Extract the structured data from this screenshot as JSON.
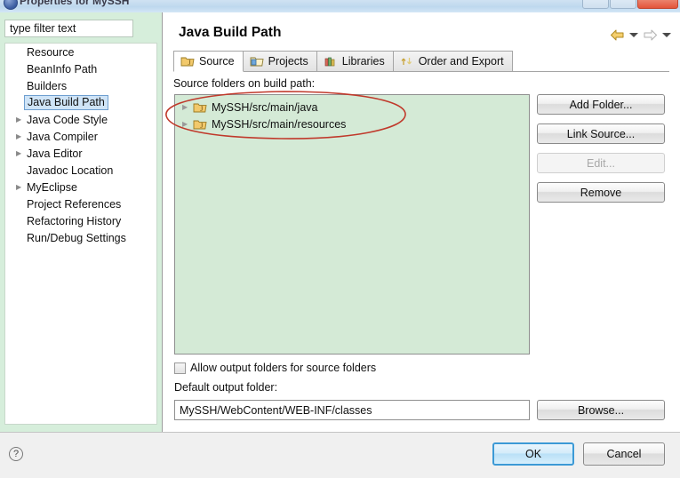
{
  "window": {
    "title": "Properties for MySSH",
    "icon": "properties-icon",
    "controls": {
      "minimize": "",
      "maximize": "",
      "close": ""
    }
  },
  "sidebar": {
    "filter": {
      "value": "type filter text",
      "placeholder": "type filter text"
    },
    "items": [
      {
        "label": "Resource",
        "expandable": false,
        "selected": false
      },
      {
        "label": "BeanInfo Path",
        "expandable": false,
        "selected": false
      },
      {
        "label": "Builders",
        "expandable": false,
        "selected": false
      },
      {
        "label": "Java Build Path",
        "expandable": false,
        "selected": true
      },
      {
        "label": "Java Code Style",
        "expandable": true,
        "selected": false
      },
      {
        "label": "Java Compiler",
        "expandable": true,
        "selected": false
      },
      {
        "label": "Java Editor",
        "expandable": true,
        "selected": false
      },
      {
        "label": "Javadoc Location",
        "expandable": false,
        "selected": false
      },
      {
        "label": "MyEclipse",
        "expandable": true,
        "selected": false
      },
      {
        "label": "Project References",
        "expandable": false,
        "selected": false
      },
      {
        "label": "Refactoring History",
        "expandable": false,
        "selected": false
      },
      {
        "label": "Run/Debug Settings",
        "expandable": false,
        "selected": false
      }
    ]
  },
  "content": {
    "title": "Java Build Path",
    "nav": {
      "back_icon": "back-arrow-icon",
      "back_dropdown_icon": "chevron-down-icon",
      "forward_icon": "forward-arrow-icon",
      "forward_dropdown_icon": "chevron-down-icon"
    },
    "tabs": [
      {
        "label": "Source",
        "icon": "source-folder-icon",
        "active": true
      },
      {
        "label": "Projects",
        "icon": "projects-folder-icon",
        "active": false
      },
      {
        "label": "Libraries",
        "icon": "libraries-books-icon",
        "active": false
      },
      {
        "label": "Order and Export",
        "icon": "order-export-arrows-icon",
        "active": false
      }
    ],
    "group_label": "Source folders on build path:",
    "source_folders": [
      {
        "label": "MySSH/src/main/java",
        "icon": "java-source-folder-icon"
      },
      {
        "label": "MySSH/src/main/resources",
        "icon": "java-source-folder-icon"
      }
    ],
    "side_buttons": [
      {
        "label": "Add Folder...",
        "disabled": false
      },
      {
        "label": "Link Source...",
        "disabled": false
      },
      {
        "label": "Edit...",
        "disabled": true
      },
      {
        "label": "Remove",
        "disabled": false
      }
    ],
    "allow_output_checkbox": {
      "label": "Allow output folders for source folders",
      "checked": false
    },
    "default_output": {
      "label": "Default output folder:",
      "value": "MySSH/WebContent/WEB-INF/classes",
      "browse_label": "Browse..."
    }
  },
  "footer": {
    "help_icon": "help-question-icon",
    "help_glyph": "?",
    "ok_label": "OK",
    "cancel_label": "Cancel"
  },
  "annotation": {
    "type": "hand-drawn-ellipse",
    "color": "#c0392b",
    "target": "source folders list entries"
  },
  "colors": {
    "sidebar_bg": "#d6eedb",
    "list_bg": "#d4ead6",
    "selection": "#cfe4f7",
    "annotation": "#c0392b",
    "primary_button_border": "#3c9ad6"
  }
}
